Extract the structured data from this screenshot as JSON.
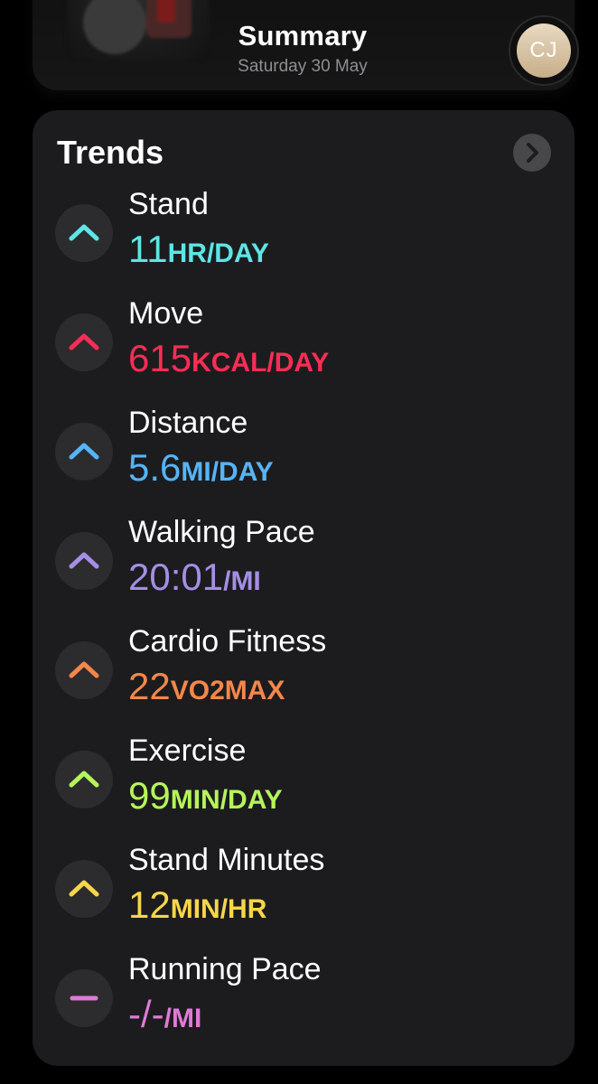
{
  "header": {
    "title": "Summary",
    "date": "Saturday 30 May",
    "avatar_initials": "CJ"
  },
  "trends": {
    "title": "Trends",
    "items": [
      {
        "label": "Stand",
        "value": "11",
        "unit": "HR/DAY",
        "direction": "up",
        "icon": "chevron-up-icon",
        "color": "#5ce6e6"
      },
      {
        "label": "Move",
        "value": "615",
        "unit": "KCAL/DAY",
        "direction": "up",
        "icon": "chevron-up-icon",
        "color": "#fa2d55"
      },
      {
        "label": "Distance",
        "value": "5.6",
        "unit": "MI/DAY",
        "direction": "up",
        "icon": "chevron-up-icon",
        "color": "#56b4f7"
      },
      {
        "label": "Walking Pace",
        "value": "20:01",
        "unit": "/MI",
        "direction": "up",
        "icon": "chevron-up-icon",
        "color": "#a58ee6"
      },
      {
        "label": "Cardio Fitness",
        "value": "22",
        "unit": "VO2MAX",
        "direction": "up",
        "icon": "chevron-up-icon",
        "color": "#f5874a"
      },
      {
        "label": "Exercise",
        "value": "99",
        "unit": "MIN/DAY",
        "direction": "up",
        "icon": "chevron-up-icon",
        "color": "#b5f55a"
      },
      {
        "label": "Stand Minutes",
        "value": "12",
        "unit": "MIN/HR",
        "direction": "up",
        "icon": "chevron-up-icon",
        "color": "#f7d64a"
      },
      {
        "label": "Running Pace",
        "value": "-/-",
        "unit": "/MI",
        "direction": "neutral",
        "icon": "dash-icon",
        "color": "#e07ad6"
      }
    ]
  }
}
